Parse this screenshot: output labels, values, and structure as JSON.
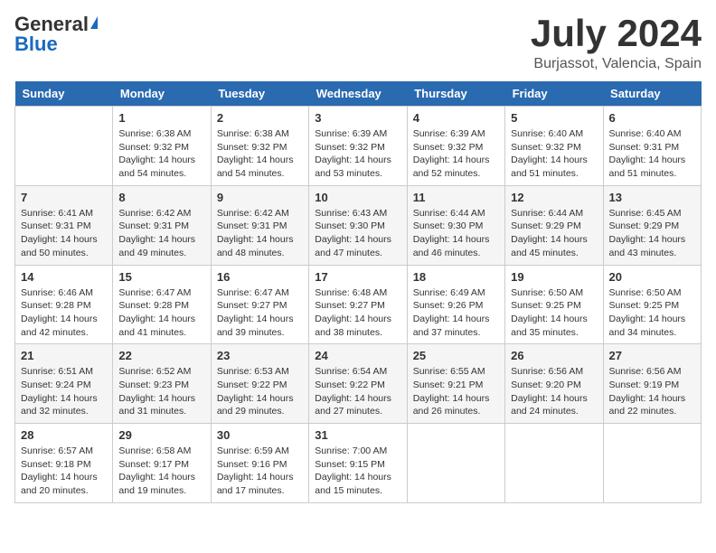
{
  "header": {
    "logo_general": "General",
    "logo_blue": "Blue",
    "title": "July 2024",
    "location": "Burjassot, Valencia, Spain"
  },
  "calendar": {
    "days_of_week": [
      "Sunday",
      "Monday",
      "Tuesday",
      "Wednesday",
      "Thursday",
      "Friday",
      "Saturday"
    ],
    "weeks": [
      [
        {
          "day": "",
          "info": ""
        },
        {
          "day": "1",
          "info": "Sunrise: 6:38 AM\nSunset: 9:32 PM\nDaylight: 14 hours and 54 minutes."
        },
        {
          "day": "2",
          "info": "Sunrise: 6:38 AM\nSunset: 9:32 PM\nDaylight: 14 hours and 54 minutes."
        },
        {
          "day": "3",
          "info": "Sunrise: 6:39 AM\nSunset: 9:32 PM\nDaylight: 14 hours and 53 minutes."
        },
        {
          "day": "4",
          "info": "Sunrise: 6:39 AM\nSunset: 9:32 PM\nDaylight: 14 hours and 52 minutes."
        },
        {
          "day": "5",
          "info": "Sunrise: 6:40 AM\nSunset: 9:32 PM\nDaylight: 14 hours and 51 minutes."
        },
        {
          "day": "6",
          "info": "Sunrise: 6:40 AM\nSunset: 9:31 PM\nDaylight: 14 hours and 51 minutes."
        }
      ],
      [
        {
          "day": "7",
          "info": "Sunrise: 6:41 AM\nSunset: 9:31 PM\nDaylight: 14 hours and 50 minutes."
        },
        {
          "day": "8",
          "info": "Sunrise: 6:42 AM\nSunset: 9:31 PM\nDaylight: 14 hours and 49 minutes."
        },
        {
          "day": "9",
          "info": "Sunrise: 6:42 AM\nSunset: 9:31 PM\nDaylight: 14 hours and 48 minutes."
        },
        {
          "day": "10",
          "info": "Sunrise: 6:43 AM\nSunset: 9:30 PM\nDaylight: 14 hours and 47 minutes."
        },
        {
          "day": "11",
          "info": "Sunrise: 6:44 AM\nSunset: 9:30 PM\nDaylight: 14 hours and 46 minutes."
        },
        {
          "day": "12",
          "info": "Sunrise: 6:44 AM\nSunset: 9:29 PM\nDaylight: 14 hours and 45 minutes."
        },
        {
          "day": "13",
          "info": "Sunrise: 6:45 AM\nSunset: 9:29 PM\nDaylight: 14 hours and 43 minutes."
        }
      ],
      [
        {
          "day": "14",
          "info": "Sunrise: 6:46 AM\nSunset: 9:28 PM\nDaylight: 14 hours and 42 minutes."
        },
        {
          "day": "15",
          "info": "Sunrise: 6:47 AM\nSunset: 9:28 PM\nDaylight: 14 hours and 41 minutes."
        },
        {
          "day": "16",
          "info": "Sunrise: 6:47 AM\nSunset: 9:27 PM\nDaylight: 14 hours and 39 minutes."
        },
        {
          "day": "17",
          "info": "Sunrise: 6:48 AM\nSunset: 9:27 PM\nDaylight: 14 hours and 38 minutes."
        },
        {
          "day": "18",
          "info": "Sunrise: 6:49 AM\nSunset: 9:26 PM\nDaylight: 14 hours and 37 minutes."
        },
        {
          "day": "19",
          "info": "Sunrise: 6:50 AM\nSunset: 9:25 PM\nDaylight: 14 hours and 35 minutes."
        },
        {
          "day": "20",
          "info": "Sunrise: 6:50 AM\nSunset: 9:25 PM\nDaylight: 14 hours and 34 minutes."
        }
      ],
      [
        {
          "day": "21",
          "info": "Sunrise: 6:51 AM\nSunset: 9:24 PM\nDaylight: 14 hours and 32 minutes."
        },
        {
          "day": "22",
          "info": "Sunrise: 6:52 AM\nSunset: 9:23 PM\nDaylight: 14 hours and 31 minutes."
        },
        {
          "day": "23",
          "info": "Sunrise: 6:53 AM\nSunset: 9:22 PM\nDaylight: 14 hours and 29 minutes."
        },
        {
          "day": "24",
          "info": "Sunrise: 6:54 AM\nSunset: 9:22 PM\nDaylight: 14 hours and 27 minutes."
        },
        {
          "day": "25",
          "info": "Sunrise: 6:55 AM\nSunset: 9:21 PM\nDaylight: 14 hours and 26 minutes."
        },
        {
          "day": "26",
          "info": "Sunrise: 6:56 AM\nSunset: 9:20 PM\nDaylight: 14 hours and 24 minutes."
        },
        {
          "day": "27",
          "info": "Sunrise: 6:56 AM\nSunset: 9:19 PM\nDaylight: 14 hours and 22 minutes."
        }
      ],
      [
        {
          "day": "28",
          "info": "Sunrise: 6:57 AM\nSunset: 9:18 PM\nDaylight: 14 hours and 20 minutes."
        },
        {
          "day": "29",
          "info": "Sunrise: 6:58 AM\nSunset: 9:17 PM\nDaylight: 14 hours and 19 minutes."
        },
        {
          "day": "30",
          "info": "Sunrise: 6:59 AM\nSunset: 9:16 PM\nDaylight: 14 hours and 17 minutes."
        },
        {
          "day": "31",
          "info": "Sunrise: 7:00 AM\nSunset: 9:15 PM\nDaylight: 14 hours and 15 minutes."
        },
        {
          "day": "",
          "info": ""
        },
        {
          "day": "",
          "info": ""
        },
        {
          "day": "",
          "info": ""
        }
      ]
    ]
  }
}
